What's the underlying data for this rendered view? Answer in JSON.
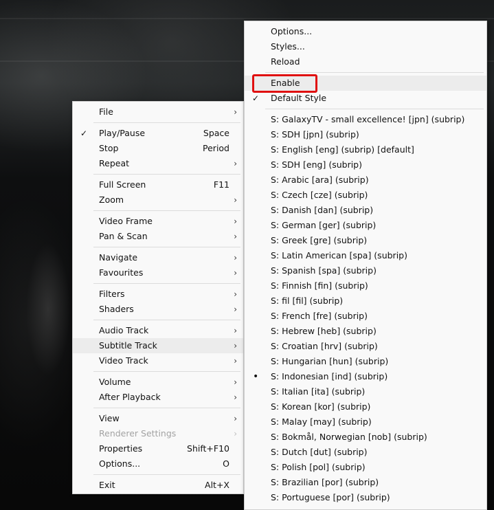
{
  "context_menu": {
    "groups": [
      [
        {
          "label": "File",
          "submenu": true
        }
      ],
      [
        {
          "label": "Play/Pause",
          "shortcut": "Space",
          "checked": true
        },
        {
          "label": "Stop",
          "shortcut": "Period"
        },
        {
          "label": "Repeat",
          "submenu": true
        }
      ],
      [
        {
          "label": "Full Screen",
          "shortcut": "F11"
        },
        {
          "label": "Zoom",
          "submenu": true
        }
      ],
      [
        {
          "label": "Video Frame",
          "submenu": true
        },
        {
          "label": "Pan & Scan",
          "submenu": true
        }
      ],
      [
        {
          "label": "Navigate",
          "submenu": true
        },
        {
          "label": "Favourites",
          "submenu": true
        }
      ],
      [
        {
          "label": "Filters",
          "submenu": true
        },
        {
          "label": "Shaders",
          "submenu": true
        }
      ],
      [
        {
          "label": "Audio Track",
          "submenu": true
        },
        {
          "label": "Subtitle Track",
          "submenu": true,
          "highlighted": true
        },
        {
          "label": "Video Track",
          "submenu": true
        }
      ],
      [
        {
          "label": "Volume",
          "submenu": true
        },
        {
          "label": "After Playback",
          "submenu": true
        }
      ],
      [
        {
          "label": "View",
          "submenu": true
        },
        {
          "label": "Renderer Settings",
          "submenu": true,
          "disabled": true
        },
        {
          "label": "Properties",
          "shortcut": "Shift+F10"
        },
        {
          "label": "Options...",
          "shortcut": "O"
        }
      ],
      [
        {
          "label": "Exit",
          "shortcut": "Alt+X"
        }
      ]
    ]
  },
  "subtitle_submenu": {
    "groups": [
      [
        {
          "label": "Options..."
        },
        {
          "label": "Styles..."
        },
        {
          "label": "Reload"
        }
      ],
      [
        {
          "label": "Enable",
          "highlighted": true
        },
        {
          "label": "Default Style",
          "checked": true
        }
      ],
      [
        {
          "label": "S: GalaxyTV - small excellence! [jpn] (subrip)"
        },
        {
          "label": "S: SDH [jpn] (subrip)"
        },
        {
          "label": "S: English [eng] (subrip) [default]"
        },
        {
          "label": "S: SDH [eng] (subrip)"
        },
        {
          "label": "S: Arabic [ara] (subrip)"
        },
        {
          "label": "S: Czech [cze] (subrip)"
        },
        {
          "label": "S: Danish [dan] (subrip)"
        },
        {
          "label": "S: German [ger] (subrip)"
        },
        {
          "label": "S: Greek [gre] (subrip)"
        },
        {
          "label": "S: Latin American [spa] (subrip)"
        },
        {
          "label": "S: Spanish [spa] (subrip)"
        },
        {
          "label": "S: Finnish [fin] (subrip)"
        },
        {
          "label": "S: fil [fil] (subrip)"
        },
        {
          "label": "S: French [fre] (subrip)"
        },
        {
          "label": "S: Hebrew [heb] (subrip)"
        },
        {
          "label": "S: Croatian [hrv] (subrip)"
        },
        {
          "label": "S: Hungarian [hun] (subrip)"
        },
        {
          "label": "S: Indonesian [ind] (subrip)",
          "selected": true
        },
        {
          "label": "S: Italian [ita] (subrip)"
        },
        {
          "label": "S: Korean [kor] (subrip)"
        },
        {
          "label": "S: Malay [may] (subrip)"
        },
        {
          "label": "S: Bokmål, Norwegian [nob] (subrip)"
        },
        {
          "label": "S: Dutch [dut] (subrip)"
        },
        {
          "label": "S: Polish [pol] (subrip)"
        },
        {
          "label": "S: Brazilian [por] (subrip)"
        },
        {
          "label": "S: Portuguese [por] (subrip)"
        }
      ]
    ]
  },
  "icons": {
    "check": "✓",
    "arrow": "›",
    "bullet": "•"
  },
  "colors": {
    "annotation_box": "#e01010",
    "menu_bg": "#f9f9f9",
    "highlight": "#ececec"
  }
}
